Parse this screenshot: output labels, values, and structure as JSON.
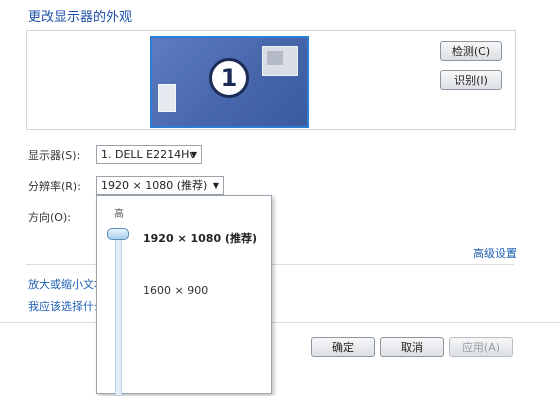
{
  "title": "更改显示器的外观",
  "preview": {
    "monitor_number": "1"
  },
  "buttons": {
    "detect": "检测(C)",
    "identify": "识别(I)",
    "ok": "确定",
    "cancel": "取消",
    "apply": "应用(A)"
  },
  "display": {
    "label": "显示器(S):",
    "value": "1. DELL E2214Hv"
  },
  "resolution": {
    "label": "分辨率(R):",
    "value": "1920 × 1080 (推荐)",
    "dropdown": {
      "high_label": "高",
      "options": [
        "1920 × 1080 (推荐)",
        "1600 × 900"
      ],
      "selected_index": 0
    }
  },
  "orientation": {
    "label": "方向(O):"
  },
  "links": {
    "advanced": "高级设置",
    "enlarge_text": "放大或缩小文本",
    "choose": "我应该选择什么"
  },
  "colors": {
    "link": "#1e5fb3",
    "title": "#1e4fa8",
    "monitor_blue": "#3a5fa8"
  }
}
